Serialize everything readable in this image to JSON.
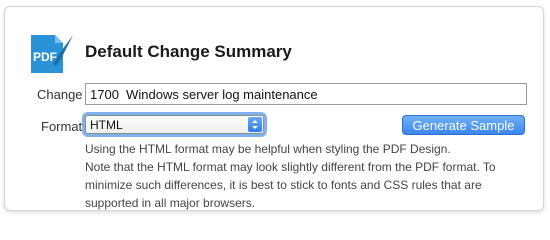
{
  "header": {
    "title": "Default Change Summary",
    "logo_text": "PDF",
    "logo_icon": "pdf-brush-icon",
    "logo_color": "#2a93d8"
  },
  "change": {
    "label": "Change",
    "value": "1700  Windows server log maintenance"
  },
  "format": {
    "label": "Format",
    "selected": "HTML"
  },
  "generate_button": {
    "label": "Generate Sample",
    "color": "#3b87ee"
  },
  "help": {
    "line1": "Using the HTML format may be helpful when styling the PDF Design.",
    "line2": "Note that the HTML format may look slightly different from the PDF format. To minimize such differences, it is best to stick to fonts and CSS rules that are supported in all major browsers."
  }
}
